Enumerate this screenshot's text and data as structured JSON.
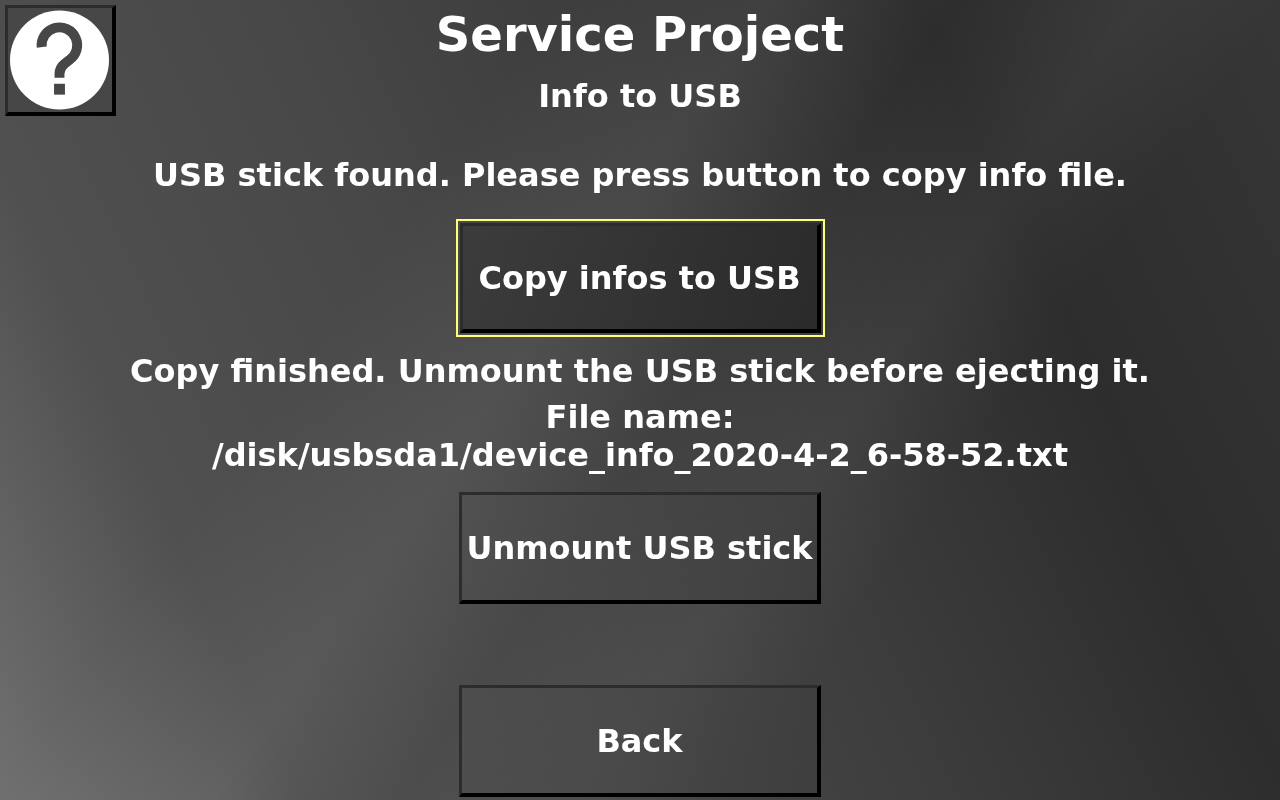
{
  "header": {
    "title": "Service Project",
    "subtitle": "Info to USB"
  },
  "instruction": "USB stick found. Please press button to copy info file.",
  "copy_button": {
    "label": "Copy infos to USB",
    "focused": true
  },
  "result": {
    "message": "Copy finished. Unmount the USB stick before ejecting it.",
    "file_label": "File name:",
    "file_path": "/disk/usbsda1/device_info_2020-4-2_6-58-52.txt"
  },
  "unmount_button": {
    "label": "Unmount USB stick",
    "focused": false
  },
  "back_button": {
    "label": "Back",
    "focused": false
  }
}
